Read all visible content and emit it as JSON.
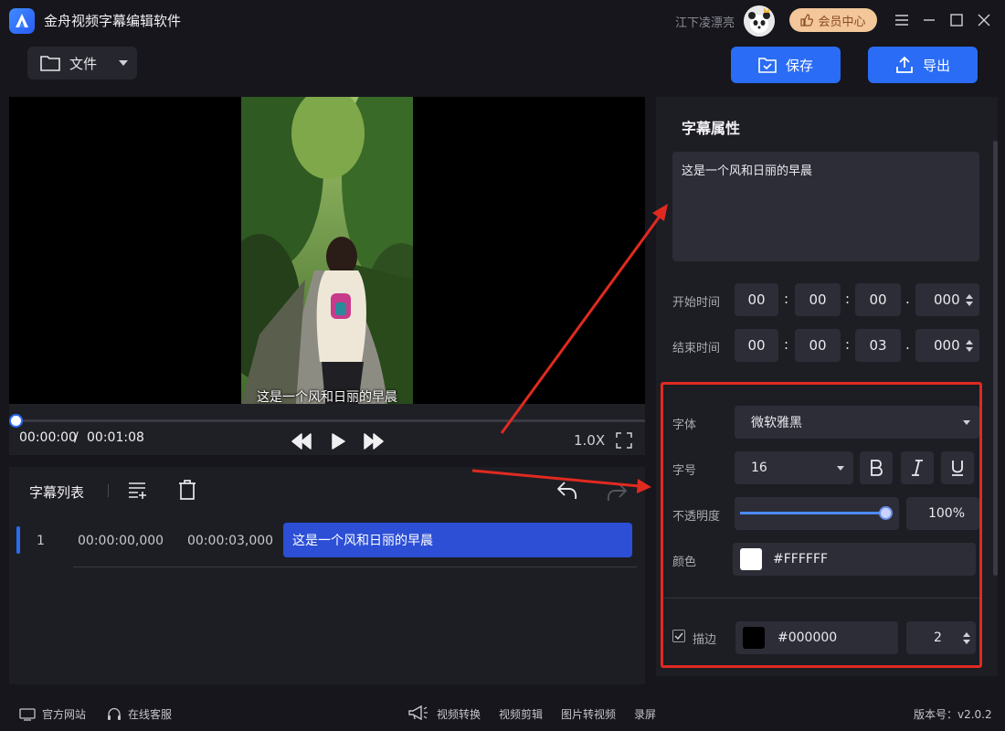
{
  "titlebar": {
    "app_title": "金舟视频字幕编辑软件",
    "user_name": "江下凌漂亮",
    "vip_label": "会员中心"
  },
  "toolbar": {
    "file_label": "文件",
    "save_label": "保存",
    "export_label": "导出"
  },
  "player": {
    "subtitle_text": "这是一个风和日丽的早晨",
    "current_time": "00:00:00",
    "time_separator": "/",
    "total_time": "00:01:08",
    "speed": "1.0X",
    "progress": 0
  },
  "subtitle_list": {
    "title": "字幕列表",
    "rows": [
      {
        "index": "1",
        "start": "00:00:00,000",
        "end": "00:00:03,000",
        "text": "这是一个风和日丽的早晨"
      }
    ]
  },
  "properties": {
    "title": "字幕属性",
    "text": "这是一个风和日丽的早晨",
    "start_label": "开始时间",
    "start_time": {
      "h": "00",
      "m": "00",
      "s": "00",
      "ms": "000"
    },
    "end_label": "结束时间",
    "end_time": {
      "h": "00",
      "m": "00",
      "s": "03",
      "ms": "000"
    },
    "font_label": "字体",
    "font_value": "微软雅黑",
    "size_label": "字号",
    "size_value": "16",
    "opacity_label": "不透明度",
    "opacity_value": "100%",
    "opacity_level": 1.0,
    "color_label": "颜色",
    "color_value": "#FFFFFF",
    "stroke_label": "描边",
    "stroke_color": "#000000",
    "stroke_width": "2"
  },
  "footer": {
    "website": "官方网站",
    "support": "在线客服",
    "video_convert": "视频转换",
    "video_edit": "视频剪辑",
    "image_to_video": "图片转视频",
    "screen_record": "录屏",
    "version": "版本号：v2.0.2"
  },
  "colors": {
    "accent": "#2a6cf5",
    "highlight_row": "#2c4fd6",
    "annotation_red": "#e02a20",
    "vip_gold": "#f3c79a"
  }
}
